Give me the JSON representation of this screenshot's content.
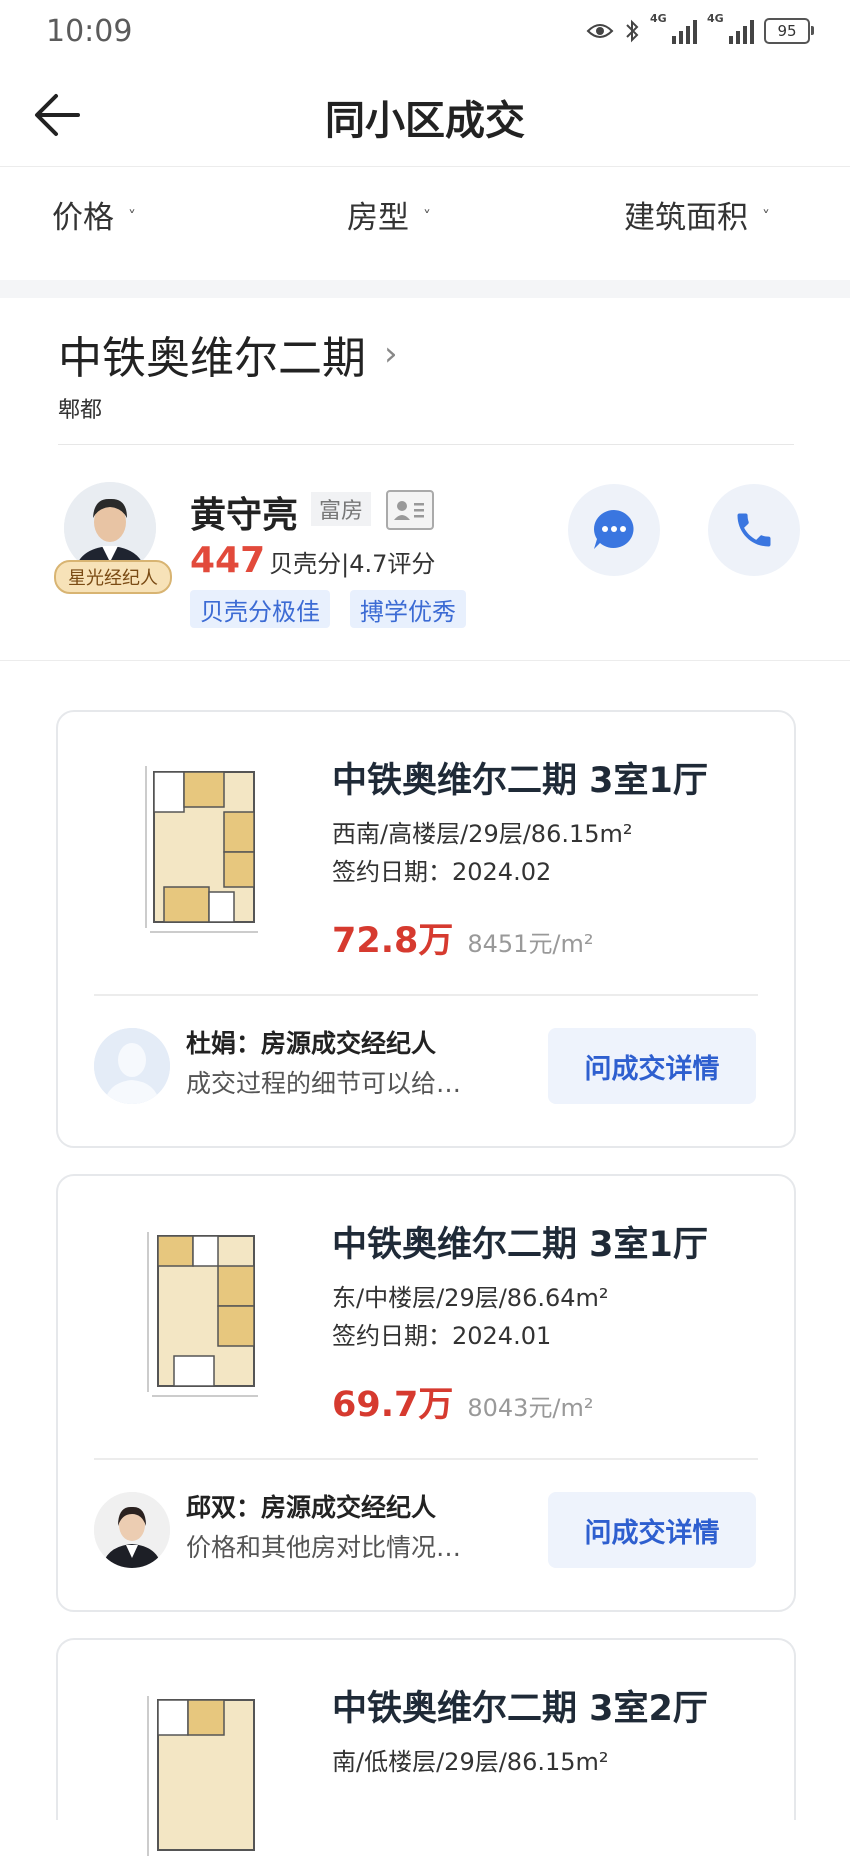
{
  "status_bar": {
    "time": "10:09",
    "battery": "95",
    "network_label": "4G",
    "icons": [
      "eye-icon",
      "bluetooth-icon",
      "signal-icon",
      "battery-icon"
    ]
  },
  "header": {
    "title": "同小区成交",
    "back_icon": "arrow-left-icon"
  },
  "filters": [
    {
      "label": "价格"
    },
    {
      "label": "房型"
    },
    {
      "label": "建筑面积"
    }
  ],
  "community": {
    "name": "中铁奥维尔二期",
    "district": "郫都"
  },
  "agent": {
    "name": "黄守亮",
    "tag": "富房",
    "badge": "星光经纪人",
    "score": "447",
    "score_text": "贝壳分|4.7评分",
    "chips": [
      "贝壳分极佳",
      "搏学优秀"
    ],
    "colors": {
      "score": "#e24a3b",
      "chip_text": "#3c6bd4"
    }
  },
  "listings": [
    {
      "title": "中铁奥维尔二期 3室1厅",
      "info": "西南/高楼层/29层/86.15m²",
      "date": "签约日期：2024.02",
      "price": "72.8万",
      "unit_price": "8451元/m²",
      "agent_role": "杜娟：房源成交经纪人",
      "agent_desc": "成交过程的细节可以给…",
      "button": "问成交详情"
    },
    {
      "title": "中铁奥维尔二期 3室1厅",
      "info": "东/中楼层/29层/86.64m²",
      "date": "签约日期：2024.01",
      "price": "69.7万",
      "unit_price": "8043元/m²",
      "agent_role": "邱双：房源成交经纪人",
      "agent_desc": "价格和其他房对比情况…",
      "button": "问成交详情"
    },
    {
      "title": "中铁奥维尔二期 3室2厅",
      "info": "南/低楼层/29层/86.15m²"
    }
  ],
  "colors": {
    "price": "#d63a2f",
    "accent_blue": "#2e5fcf"
  }
}
